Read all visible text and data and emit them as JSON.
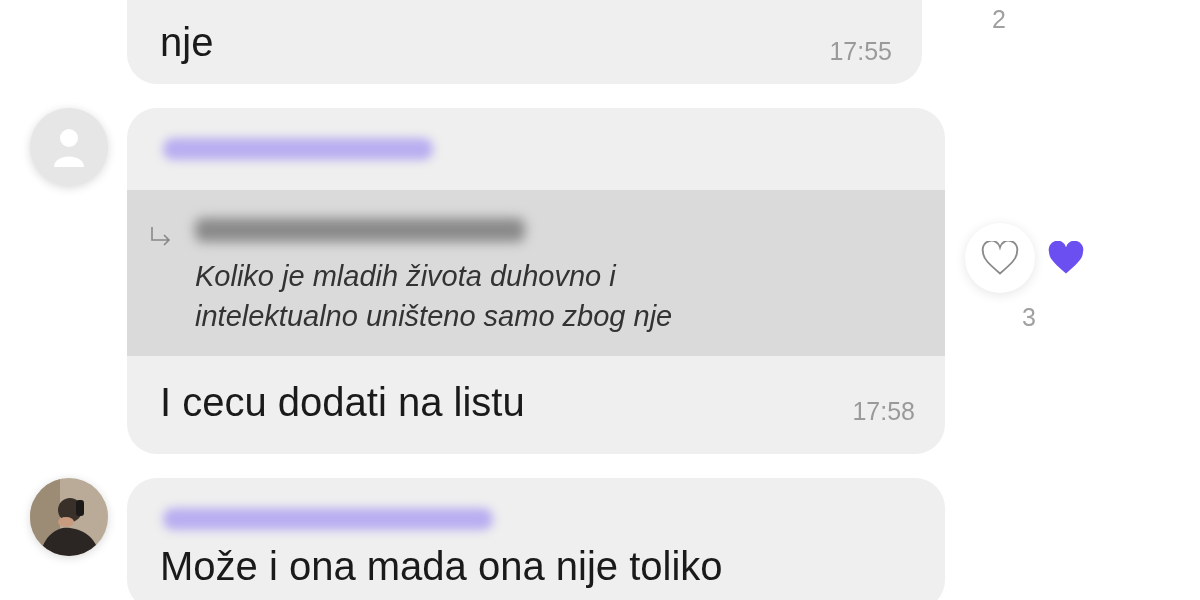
{
  "messages": [
    {
      "kind": "continued",
      "text": "nje",
      "time": "17:55",
      "reactions": {
        "count": "2"
      }
    },
    {
      "kind": "reply",
      "avatar": {
        "kind": "placeholder"
      },
      "quote": {
        "text": "Koliko je mladih života duhovno i intelektualno uništeno samo zbog nje"
      },
      "text": "I cecu dodati na listu",
      "time": "17:58",
      "reactions": {
        "liked": true,
        "count": "3"
      }
    },
    {
      "kind": "plain",
      "text": "Može i ona mada ona nije toliko"
    }
  ]
}
